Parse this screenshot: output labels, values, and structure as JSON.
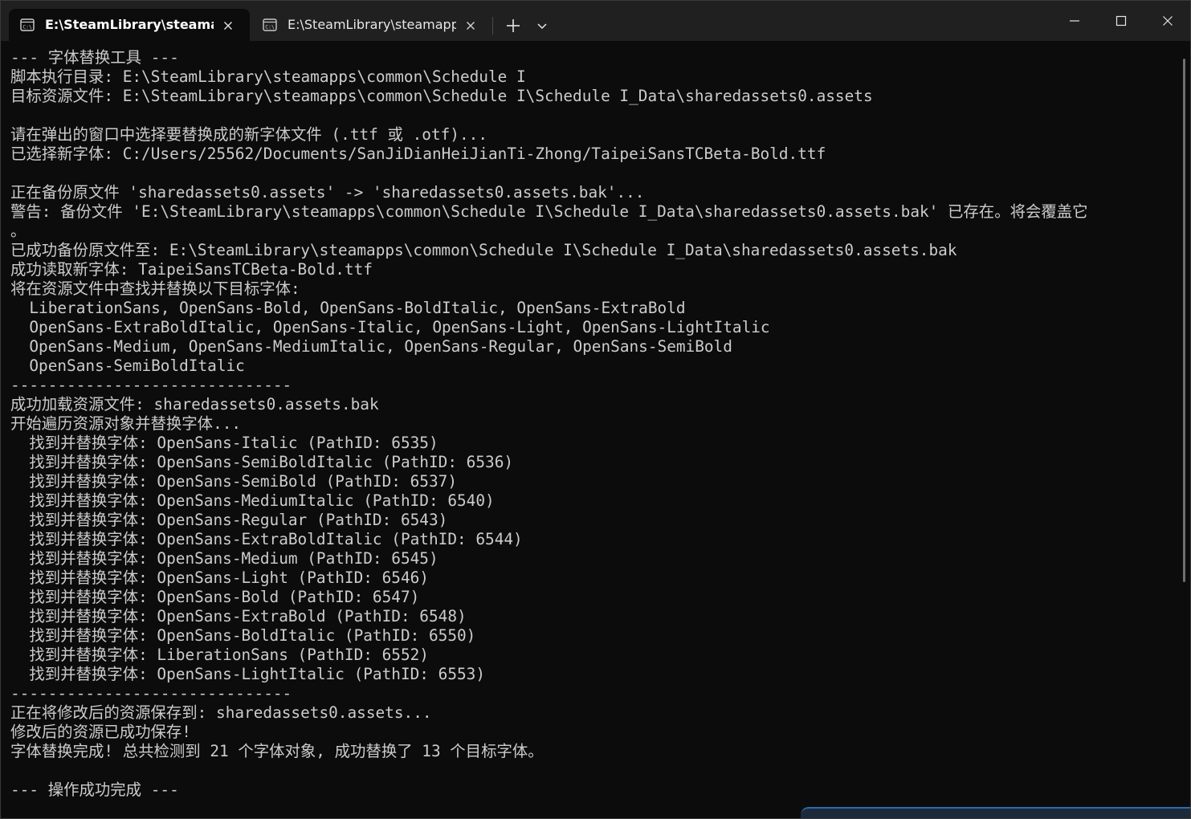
{
  "window": {
    "tabs": [
      {
        "title": "E:\\SteamLibrary\\steamapps\\common\\Schedule I",
        "active": true
      },
      {
        "title": "E:\\SteamLibrary\\steamapps\\common\\Schedule I",
        "active": false
      }
    ],
    "icons": {
      "tab": "terminal-icon",
      "close": "close-icon",
      "new_tab": "plus-icon",
      "dropdown": "chevron-down-icon",
      "minimize": "minimize-icon",
      "maximize": "maximize-icon",
      "close_window": "close-icon"
    },
    "colors": {
      "titlebar": "#202020",
      "background": "#0c0c0c",
      "text": "#cccccc"
    }
  },
  "terminal": {
    "lines": [
      "--- 字体替换工具 ---",
      "脚本执行目录: E:\\SteamLibrary\\steamapps\\common\\Schedule I",
      "目标资源文件: E:\\SteamLibrary\\steamapps\\common\\Schedule I\\Schedule I_Data\\sharedassets0.assets",
      "",
      "请在弹出的窗口中选择要替换成的新字体文件 (.ttf 或 .otf)...",
      "已选择新字体: C:/Users/25562/Documents/SanJiDianHeiJianTi-Zhong/TaipeiSansTCBeta-Bold.ttf",
      "",
      "正在备份原文件 'sharedassets0.assets' -> 'sharedassets0.assets.bak'...",
      "警告: 备份文件 'E:\\SteamLibrary\\steamapps\\common\\Schedule I\\Schedule I_Data\\sharedassets0.assets.bak' 已存在。将会覆盖它",
      "。",
      "已成功备份原文件至: E:\\SteamLibrary\\steamapps\\common\\Schedule I\\Schedule I_Data\\sharedassets0.assets.bak",
      "成功读取新字体: TaipeiSansTCBeta-Bold.ttf",
      "将在资源文件中查找并替换以下目标字体:",
      "  LiberationSans, OpenSans-Bold, OpenSans-BoldItalic, OpenSans-ExtraBold",
      "  OpenSans-ExtraBoldItalic, OpenSans-Italic, OpenSans-Light, OpenSans-LightItalic",
      "  OpenSans-Medium, OpenSans-MediumItalic, OpenSans-Regular, OpenSans-SemiBold",
      "  OpenSans-SemiBoldItalic",
      "------------------------------",
      "成功加载资源文件: sharedassets0.assets.bak",
      "开始遍历资源对象并替换字体...",
      "  找到并替换字体: OpenSans-Italic (PathID: 6535)",
      "  找到并替换字体: OpenSans-SemiBoldItalic (PathID: 6536)",
      "  找到并替换字体: OpenSans-SemiBold (PathID: 6537)",
      "  找到并替换字体: OpenSans-MediumItalic (PathID: 6540)",
      "  找到并替换字体: OpenSans-Regular (PathID: 6543)",
      "  找到并替换字体: OpenSans-ExtraBoldItalic (PathID: 6544)",
      "  找到并替换字体: OpenSans-Medium (PathID: 6545)",
      "  找到并替换字体: OpenSans-Light (PathID: 6546)",
      "  找到并替换字体: OpenSans-Bold (PathID: 6547)",
      "  找到并替换字体: OpenSans-ExtraBold (PathID: 6548)",
      "  找到并替换字体: OpenSans-BoldItalic (PathID: 6550)",
      "  找到并替换字体: LiberationSans (PathID: 6552)",
      "  找到并替换字体: OpenSans-LightItalic (PathID: 6553)",
      "------------------------------",
      "正在将修改后的资源保存到: sharedassets0.assets...",
      "修改后的资源已成功保存!",
      "字体替换完成! 总共检测到 21 个字体对象, 成功替换了 13 个目标字体。",
      "",
      "--- 操作成功完成 ---"
    ]
  }
}
